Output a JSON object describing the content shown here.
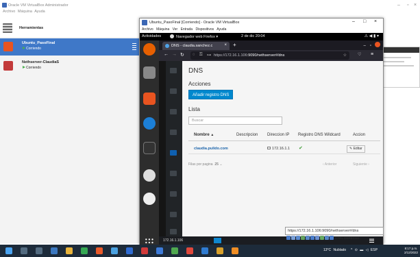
{
  "host": {
    "title": "Oracle VM VirtualBox Administrador",
    "menu": [
      "Archivo",
      "Máquina",
      "Ayuda"
    ],
    "tools_label": "Herramientas",
    "vms": [
      {
        "name": "Ubuntu_PasoFinal",
        "state": "Corriendo",
        "selected": true
      },
      {
        "name": "Nethserver-ClaudiaS",
        "state": "Corriendo",
        "selected": false
      }
    ]
  },
  "vm_window": {
    "title": "Ubuntu_PasoFinal [Corriendo] - Oracle VM VirtualBox",
    "menu": [
      "Archivo",
      "Máquina",
      "Ver",
      "Entrada",
      "Dispositivos",
      "Ayuda"
    ],
    "status_tip": "https://172.16.1.106:9090/nethserver#/dns",
    "host_key": "CTRL DERECHA"
  },
  "gnome": {
    "activities": "Actividades",
    "app_menu": "Navegador web Firefox ▾",
    "clock": "2 de dic 20:04",
    "system_icons": "⚠ ◀ ▮ ▾"
  },
  "firefox": {
    "tab_title": "DNS - claudia.sanchez.c",
    "url_host": "https://172.16.1.106",
    "url_rest": ":9090/nethserver#/dns"
  },
  "cockpit": {
    "page_title": "DNS",
    "actions_label": "Acciones",
    "add_button": "Añadir registro DNS",
    "list_label": "Lista",
    "search_placeholder": "Buscar",
    "columns": [
      "Nombre",
      "Descripcion",
      "Direccion IP",
      "Registro DNS Wildcard",
      "Accion"
    ],
    "sort_indicator": "▲",
    "rows": [
      {
        "name": "claudia.pulido.com",
        "description": "",
        "ip": "172.16.1.1",
        "wildcard": "✔",
        "action": "✎ Editar"
      }
    ],
    "pager_label": "Filas por pagina",
    "pager_size": "25",
    "pager_prev": "‹ Anterior",
    "pager_next": "Siguiente ›",
    "host_bottom": "172.16.1.106"
  },
  "taskbar": {
    "weather": "13°C Nublado",
    "lang": "ESP",
    "time": "8:17 p.m.",
    "date": "2/12/2022"
  },
  "colors": {
    "selection_blue": "#3f78c8",
    "ubuntu_orange": "#e95420",
    "cockpit_primary": "#0088ce",
    "link_blue": "#1a63aa",
    "taskbar": "#1d2b3a"
  }
}
